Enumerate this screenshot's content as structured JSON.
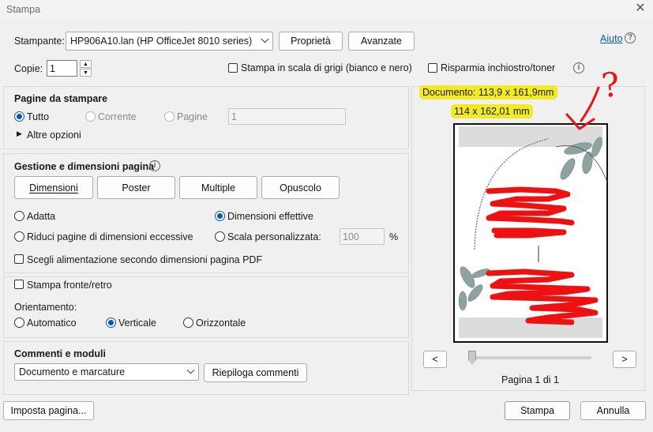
{
  "window": {
    "title": "Stampa"
  },
  "printer": {
    "label": "Stampante:",
    "selected": "HP906A10.lan (HP OfficeJet 8010 series)",
    "properties_button": "Proprietà",
    "advanced_button": "Avanzate",
    "help_link": "Aiuto"
  },
  "copies": {
    "label": "Copie:",
    "value": "1",
    "grayscale_label": "Stampa in scala di grigi (bianco e nero)",
    "save_ink_label": "Risparmia inchiostro/toner"
  },
  "pages_to_print": {
    "heading": "Pagine da stampare",
    "all_label": "Tutto",
    "current_label": "Corrente",
    "pages_label": "Pagine",
    "pages_value": "1",
    "more_options_label": "Altre opzioni"
  },
  "page_sizing": {
    "heading": "Gestione e dimensioni pagina",
    "tabs": [
      "Dimensioni",
      "Poster",
      "Multiple",
      "Opuscolo"
    ],
    "fit_label": "Adatta",
    "actual_size_label": "Dimensioni effettive",
    "shrink_label": "Riduci pagine di dimensioni eccessive",
    "custom_scale_label": "Scala personalizzata:",
    "custom_scale_value": "100",
    "percent": "%",
    "choose_source_label": "Scegli alimentazione secondo dimensioni pagina PDF"
  },
  "duplex": {
    "label": "Stampa fronte/retro",
    "orientation_label": "Orientamento:",
    "auto_label": "Automatico",
    "portrait_label": "Verticale",
    "landscape_label": "Orizzontale"
  },
  "comments": {
    "heading": "Commenti e moduli",
    "selected": "Documento e marcature",
    "summarize_button": "Riepiloga commenti"
  },
  "preview": {
    "document_size": "Documento: 113,9 x 161,9mm",
    "paper_size": "114 x 162,01 mm",
    "prev_button": "<",
    "next_button": ">",
    "page_counter": "Pagina 1 di 1",
    "annotation_mark": "?",
    "slider_value": 0
  },
  "footer": {
    "page_setup_button": "Imposta pagina...",
    "print_button": "Stampa",
    "cancel_button": "Annulla"
  },
  "colors": {
    "accent": "#0a58b8",
    "highlight": "#f2ea24",
    "scribble": "#ee1111"
  }
}
